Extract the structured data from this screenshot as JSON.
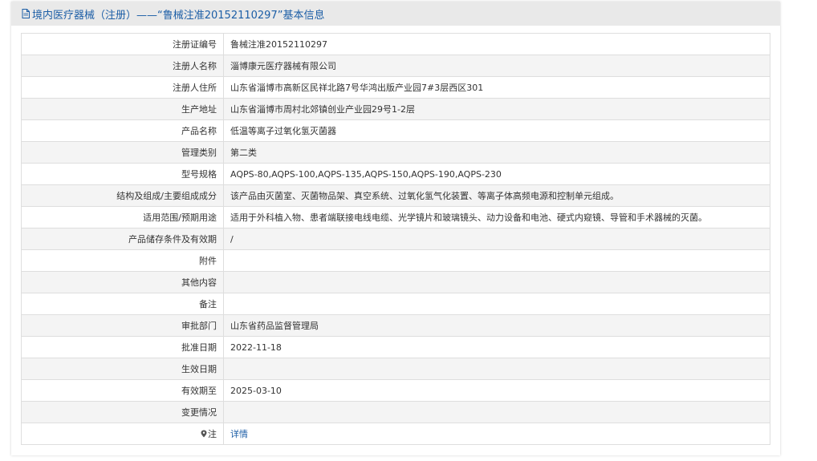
{
  "header": {
    "title": "境内医疗器械（注册）——“鲁械注准20152110297”基本信息",
    "icon": "document-icon"
  },
  "rows": [
    {
      "label": "注册证编号",
      "value": "鲁械注准20152110297"
    },
    {
      "label": "注册人名称",
      "value": "淄博康元医疗器械有限公司"
    },
    {
      "label": "注册人住所",
      "value": "山东省淄博市高新区民祥北路7号华鸿出版产业园7#3层西区301"
    },
    {
      "label": "生产地址",
      "value": "山东省淄博市周村北郊镇创业产业园29号1-2层"
    },
    {
      "label": "产品名称",
      "value": "低温等离子过氧化氢灭菌器"
    },
    {
      "label": "管理类别",
      "value": "第二类"
    },
    {
      "label": "型号规格",
      "value": "AQPS-80,AQPS-100,AQPS-135,AQPS-150,AQPS-190,AQPS-230"
    },
    {
      "label": "结构及组成/主要组成成分",
      "value": "该产品由灭菌室、灭菌物品架、真空系统、过氧化氢气化装置、等离子体高频电源和控制单元组成。"
    },
    {
      "label": "适用范围/预期用途",
      "value": "适用于外科植入物、患者端联接电线电缆、光学镜片和玻璃镜头、动力设备和电池、硬式内窥镜、导管和手术器械的灭菌。"
    },
    {
      "label": "产品储存条件及有效期",
      "value": "/"
    },
    {
      "label": "附件",
      "value": ""
    },
    {
      "label": "其他内容",
      "value": ""
    },
    {
      "label": "备注",
      "value": ""
    },
    {
      "label": "审批部门",
      "value": "山东省药品监督管理局"
    },
    {
      "label": "批准日期",
      "value": "2022-11-18"
    },
    {
      "label": "生效日期",
      "value": ""
    },
    {
      "label": "有效期至",
      "value": "2025-03-10"
    },
    {
      "label": "变更情况",
      "value": ""
    }
  ],
  "note_row": {
    "label": "注",
    "icon": "pin-icon",
    "link_text": "详情"
  },
  "colors": {
    "accent": "#1c5ea6",
    "header_bg": "#e9e9e9",
    "row_alt_bg": "#f4f4f4",
    "border": "#dedede"
  }
}
